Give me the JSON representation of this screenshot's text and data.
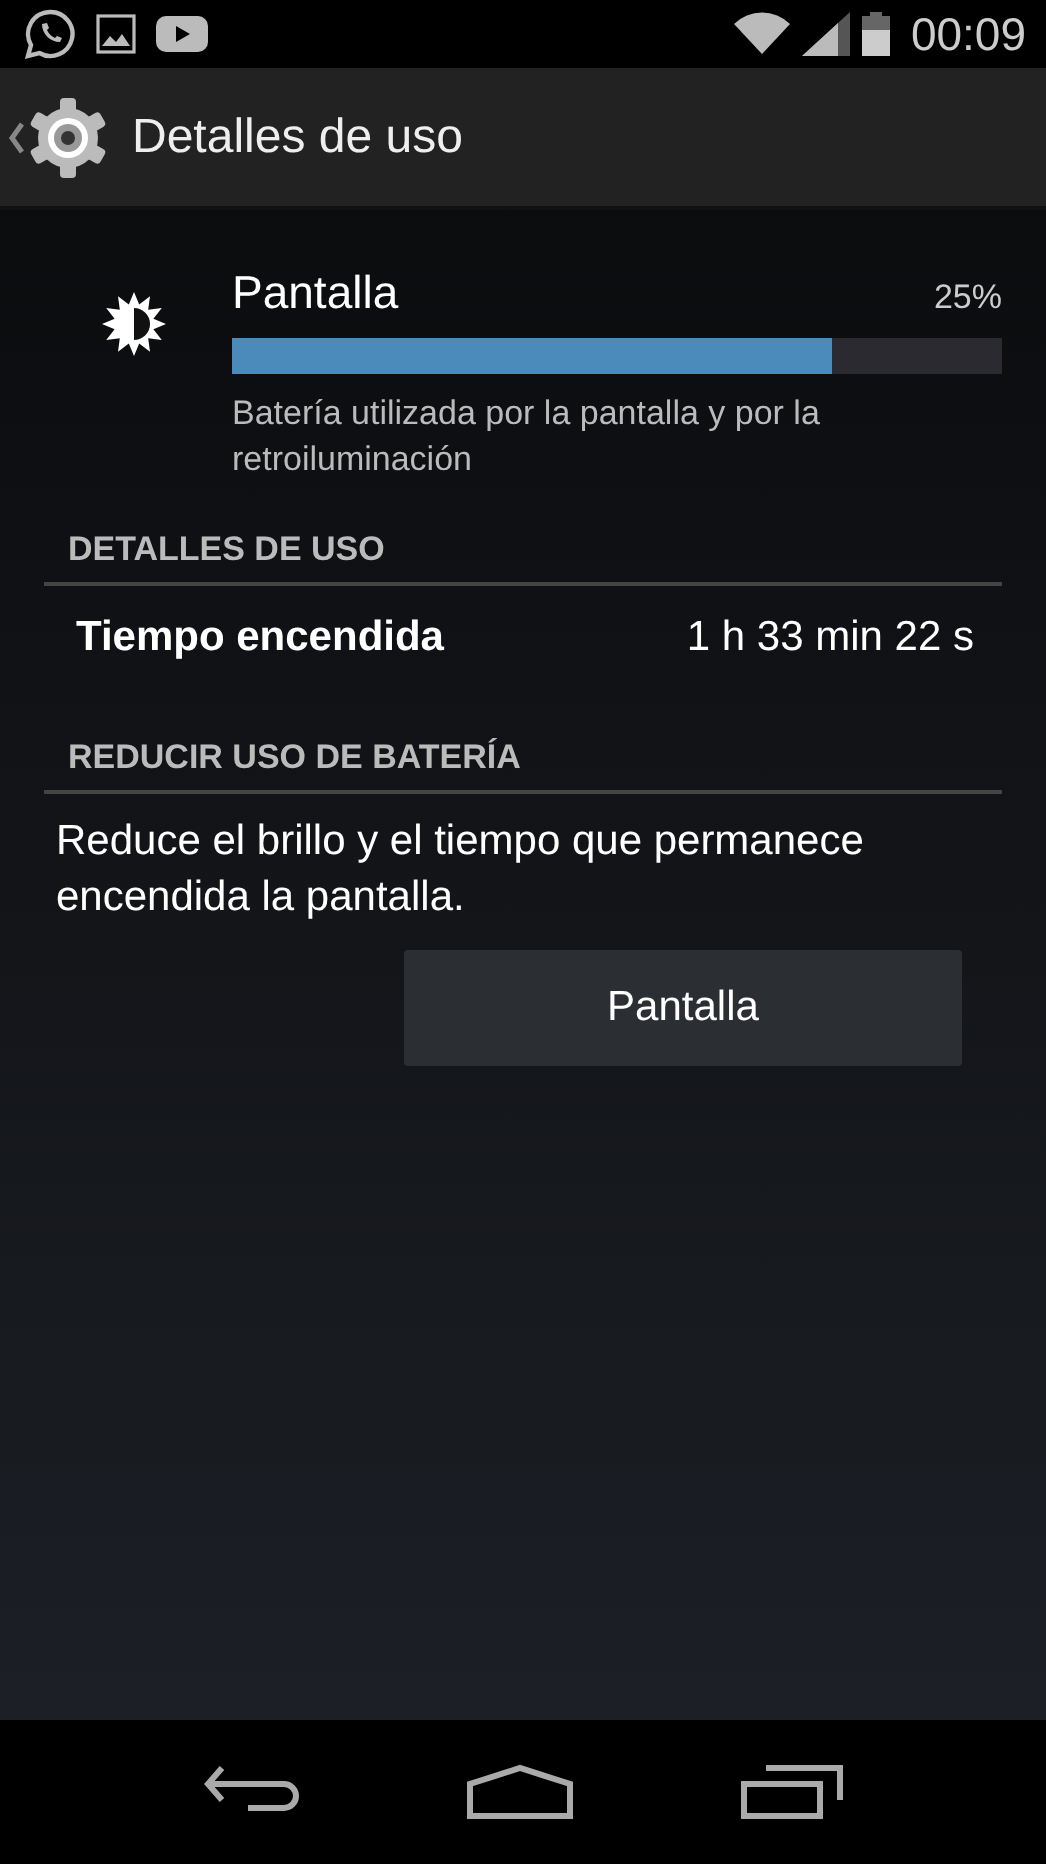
{
  "status_bar": {
    "time": "00:09"
  },
  "action_bar": {
    "title": "Detalles de uso"
  },
  "usage": {
    "name": "Pantalla",
    "percent": "25%",
    "level": 0.78,
    "description": "Batería utilizada por la pantalla y por la retroiluminación"
  },
  "details": {
    "header": "DETALLES DE USO",
    "rows": [
      {
        "label": "Tiempo encendida",
        "value": "1 h 33 min 22 s"
      }
    ]
  },
  "reduce": {
    "header": "REDUCIR USO DE BATERÍA",
    "text": "Reduce el brillo y el tiempo que permanece encendida la pantalla.",
    "button": "Pantalla"
  }
}
